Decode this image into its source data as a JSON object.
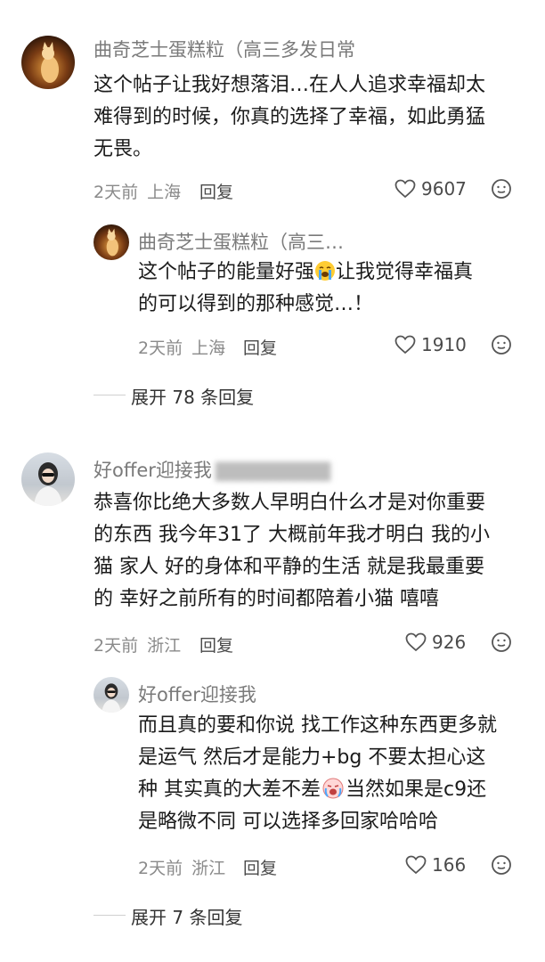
{
  "comments": [
    {
      "author": "曲奇芝士蛋糕粒（高三多发日常",
      "text": [
        "这个帖子让我好想落泪…在人人追求幸福却太",
        "难得到的时候，你真的选择了幸福，如此勇猛",
        "无畏。"
      ],
      "time": "2天前",
      "location": "上海",
      "reply_label": "回复",
      "likes": "9607",
      "reply": {
        "author": "曲奇芝士蛋糕粒（高三…",
        "text_before_emoji": "这个帖子的能量好强",
        "text_after_emoji": "让我觉得幸福真",
        "text_line2": "的可以得到的那种感觉…！",
        "time": "2天前",
        "location": "上海",
        "reply_label": "回复",
        "likes": "1910"
      },
      "expand_label": "展开 78 条回复"
    },
    {
      "author": "好offer迎接我",
      "text": [
        "恭喜你比绝大多数人早明白什么才是对你重要",
        "的东西 我今年31了 大概前年我才明白 我的小",
        "猫 家人 好的身体和平静的生活 就是我最重要",
        "的 幸好之前所有的时间都陪着小猫 嘻嘻"
      ],
      "time": "2天前",
      "location": "浙江",
      "reply_label": "回复",
      "likes": "926",
      "reply": {
        "author": "好offer迎接我",
        "text_line1": "而且真的要和你说 找工作这种东西更多就",
        "text_line2": "是运气 然后才是能力+bg 不要太担心这",
        "text_line3_before_emoji": "种 其实真的大差不差",
        "text_line3_after_emoji": "当然如果是c9还",
        "text_line4": "是略微不同 可以选择多回家哈哈哈",
        "time": "2天前",
        "location": "浙江",
        "reply_label": "回复",
        "likes": "166"
      },
      "expand_label": "展开 7 条回复"
    }
  ]
}
